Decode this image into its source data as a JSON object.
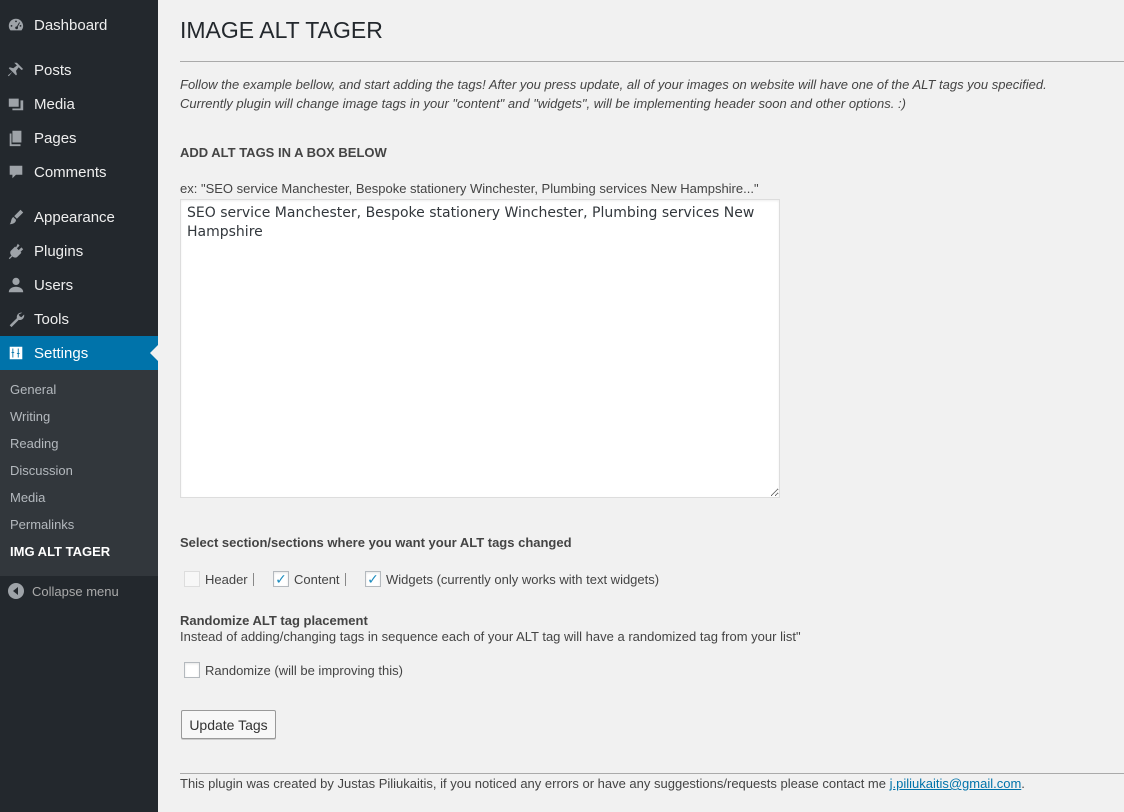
{
  "sidebar": {
    "items": [
      {
        "label": "Dashboard",
        "icon": "dashboard-icon"
      },
      {
        "label": "Posts",
        "icon": "pin-icon"
      },
      {
        "label": "Media",
        "icon": "media-icon"
      },
      {
        "label": "Pages",
        "icon": "pages-icon"
      },
      {
        "label": "Comments",
        "icon": "comment-icon"
      },
      {
        "label": "Appearance",
        "icon": "brush-icon"
      },
      {
        "label": "Plugins",
        "icon": "plug-icon"
      },
      {
        "label": "Users",
        "icon": "user-icon"
      },
      {
        "label": "Tools",
        "icon": "wrench-icon"
      },
      {
        "label": "Settings",
        "icon": "settings-icon"
      }
    ],
    "active_item": "Settings",
    "submenu": [
      "General",
      "Writing",
      "Reading",
      "Discussion",
      "Media",
      "Permalinks",
      "IMG ALT TAGER"
    ],
    "current_submenu": "IMG ALT TAGER",
    "collapse_label": "Collapse menu"
  },
  "main": {
    "title": "IMAGE ALT TAGER",
    "intro_line1": "Follow the example bellow, and start adding the tags! After you press update, all of your images on website will have one of the ALT tags you specified.",
    "intro_line2": "Currently plugin will change image tags in your \"content\" and \"widgets\", will be implementing header soon and other options. :)",
    "section_heading": "ADD ALT TAGS IN A BOX BELOW",
    "example_text": "ex: \"SEO service Manchester, Bespoke stationery Winchester, Plumbing services New Hampshire...\"",
    "textarea_value": "SEO service Manchester, Bespoke stationery Winchester, Plumbing services New Hampshire",
    "select_label": "Select section/sections where you want your ALT tags changed",
    "sections": [
      {
        "label": "Header",
        "checked": false,
        "disabled": true
      },
      {
        "label": "Content",
        "checked": true,
        "disabled": false
      },
      {
        "label": "Widgets (currently only works with text widgets)",
        "checked": true,
        "disabled": false
      }
    ],
    "randomize_heading": "Randomize ALT tag placement",
    "randomize_description": "Instead of adding/changing tags in sequence each of your ALT tag will have a randomized tag from your list\"",
    "randomize_label": "Randomize (will be improving this)",
    "randomize_checked": false,
    "update_button": "Update Tags",
    "footer_text": "This plugin was created by Justas Piliukaitis, if you noticed any errors or have any suggestions/requests please contact me ",
    "footer_email": "j.piliukaitis@gmail.com",
    "footer_end": "."
  },
  "colors": {
    "sidebar_bg": "#23282d",
    "submenu_bg": "#32373c",
    "accent": "#0073aa",
    "page_bg": "#f1f1f1",
    "checkmark": "#1e8cbe"
  }
}
